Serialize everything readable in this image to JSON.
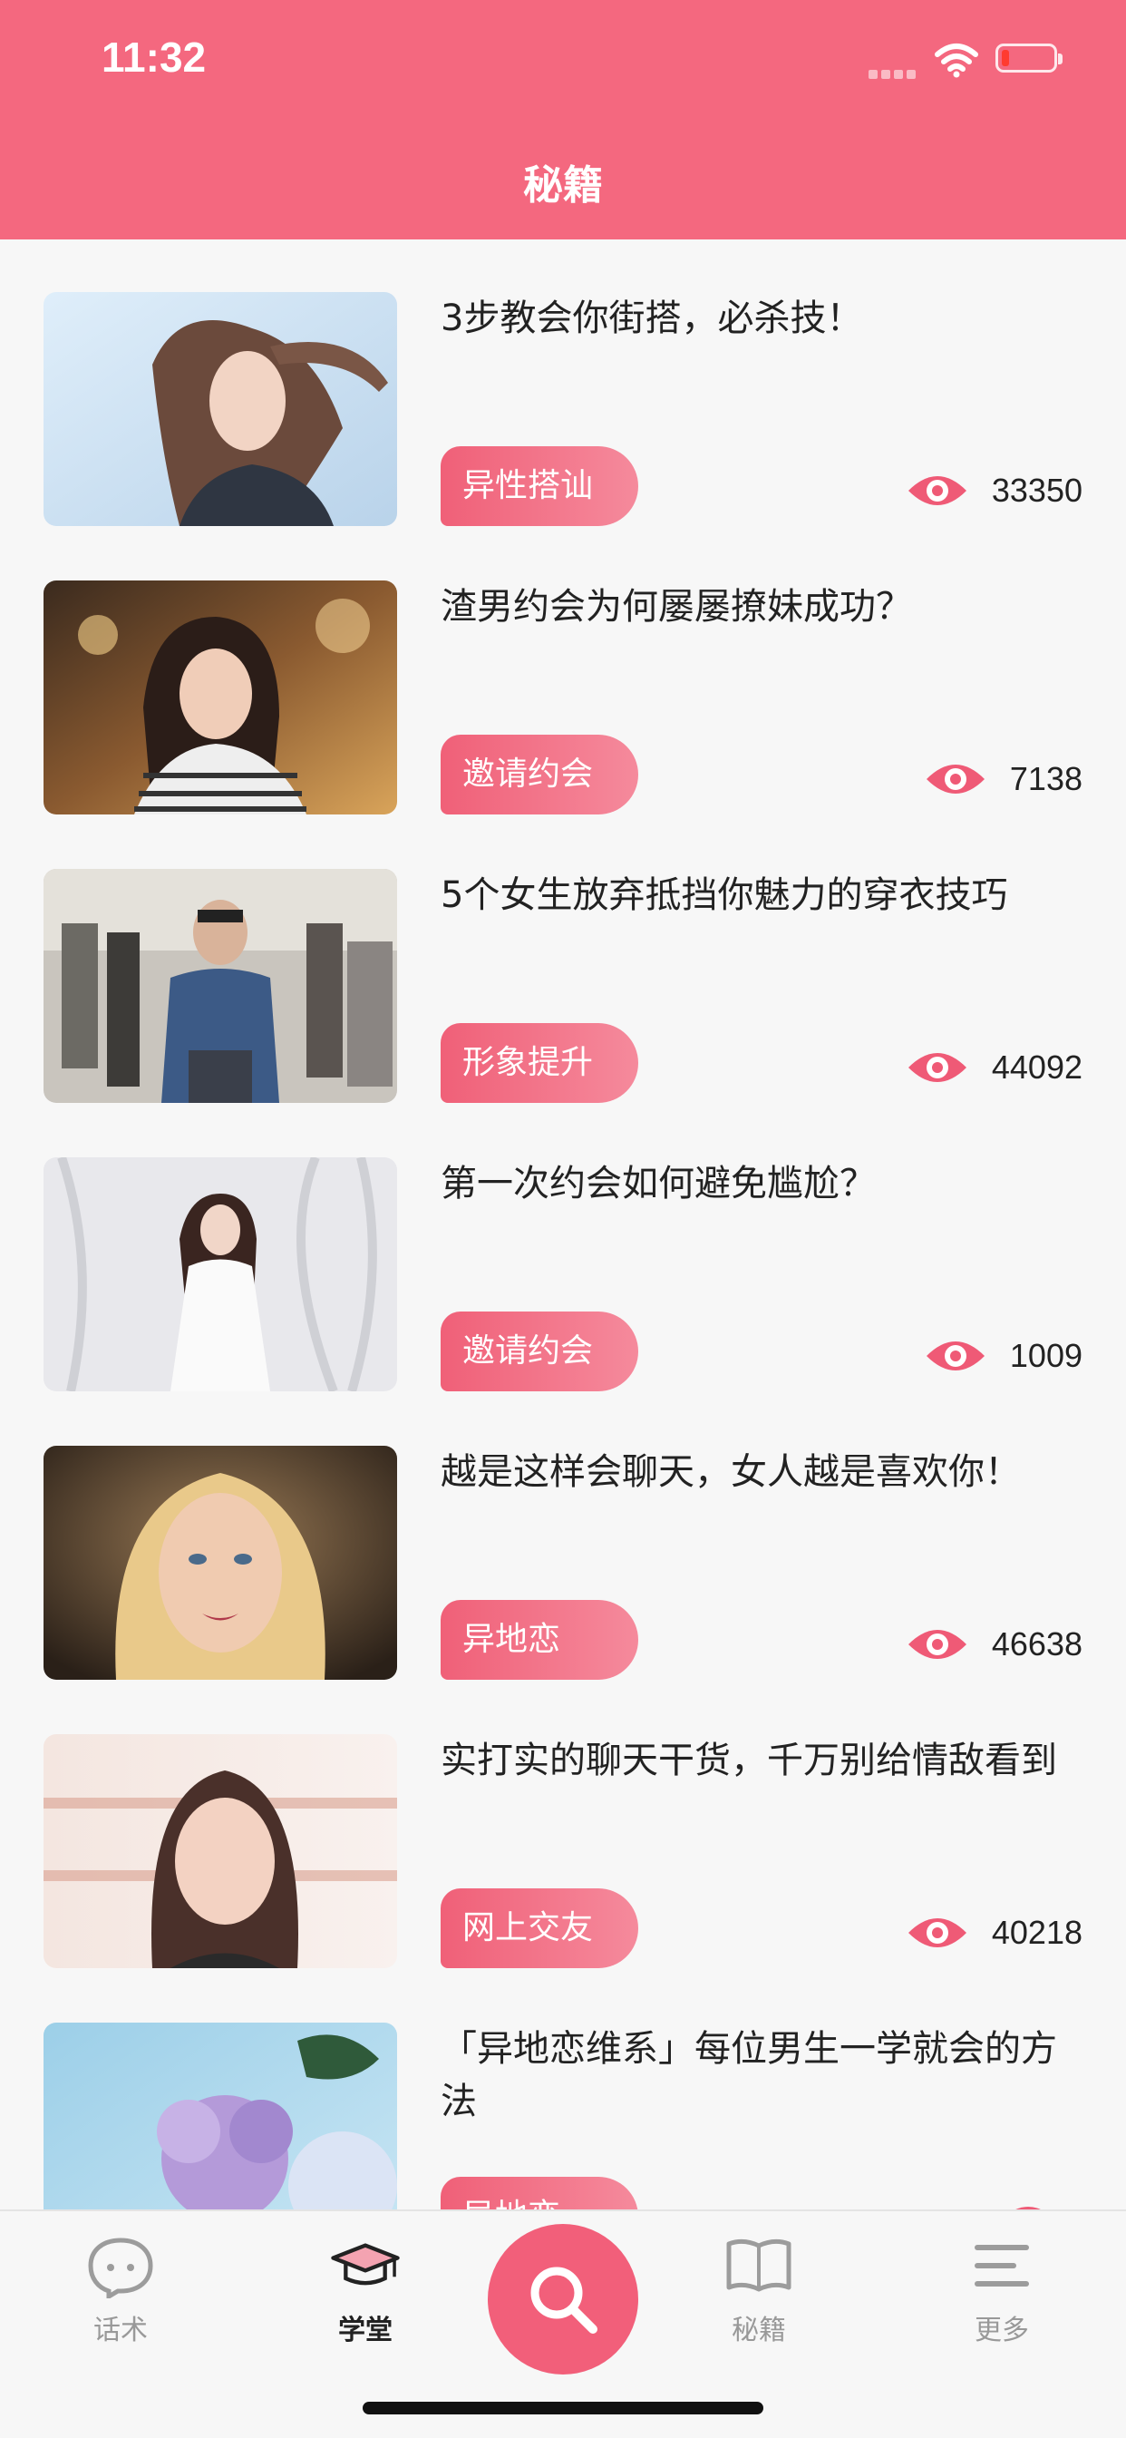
{
  "status_bar": {
    "time": "11:32"
  },
  "header": {
    "title": "秘籍"
  },
  "articles": [
    {
      "title": "3步教会你街搭，必杀技！",
      "tag": "异性搭讪",
      "views": "33350",
      "thumb": "woman-wind-hair-photo"
    },
    {
      "title": "渣男约会为何屡屡撩妹成功？",
      "tag": "邀请约会",
      "views": "7138",
      "thumb": "woman-striped-shirt-photo"
    },
    {
      "title": "5个女生放弃抵挡你魅力的穿衣技巧",
      "tag": "形象提升",
      "views": "44092",
      "thumb": "man-denim-jacket-street-photo"
    },
    {
      "title": "第一次约会如何避免尴尬？",
      "tag": "邀请约会",
      "views": "1009",
      "thumb": "woman-white-dress-photo"
    },
    {
      "title": "越是这样会聊天，女人越是喜欢你！",
      "tag": "异地恋",
      "views": "46638",
      "thumb": "blonde-woman-portrait-photo"
    },
    {
      "title": "实打实的聊天干货，千万别给情敌看到",
      "tag": "网上交友",
      "views": "40218",
      "thumb": "woman-soft-light-portrait-photo"
    },
    {
      "title": "「异地恋维系」每位男生一学就会的方法",
      "tag": "异地恋",
      "views": "",
      "thumb": "hydrangea-flowers-photo"
    }
  ],
  "tabbar": {
    "tabs": [
      {
        "label": "话术",
        "icon": "chat-bubble-icon"
      },
      {
        "label": "学堂",
        "icon": "graduation-cap-icon",
        "active": true
      },
      {
        "label": "",
        "icon": "search-icon"
      },
      {
        "label": "秘籍",
        "icon": "book-icon"
      },
      {
        "label": "更多",
        "icon": "menu-icon"
      }
    ]
  },
  "colors": {
    "brand": "#f4687f",
    "tag_gradient_start": "#f06078",
    "tag_gradient_end": "#f58a9c",
    "text": "#222222"
  }
}
